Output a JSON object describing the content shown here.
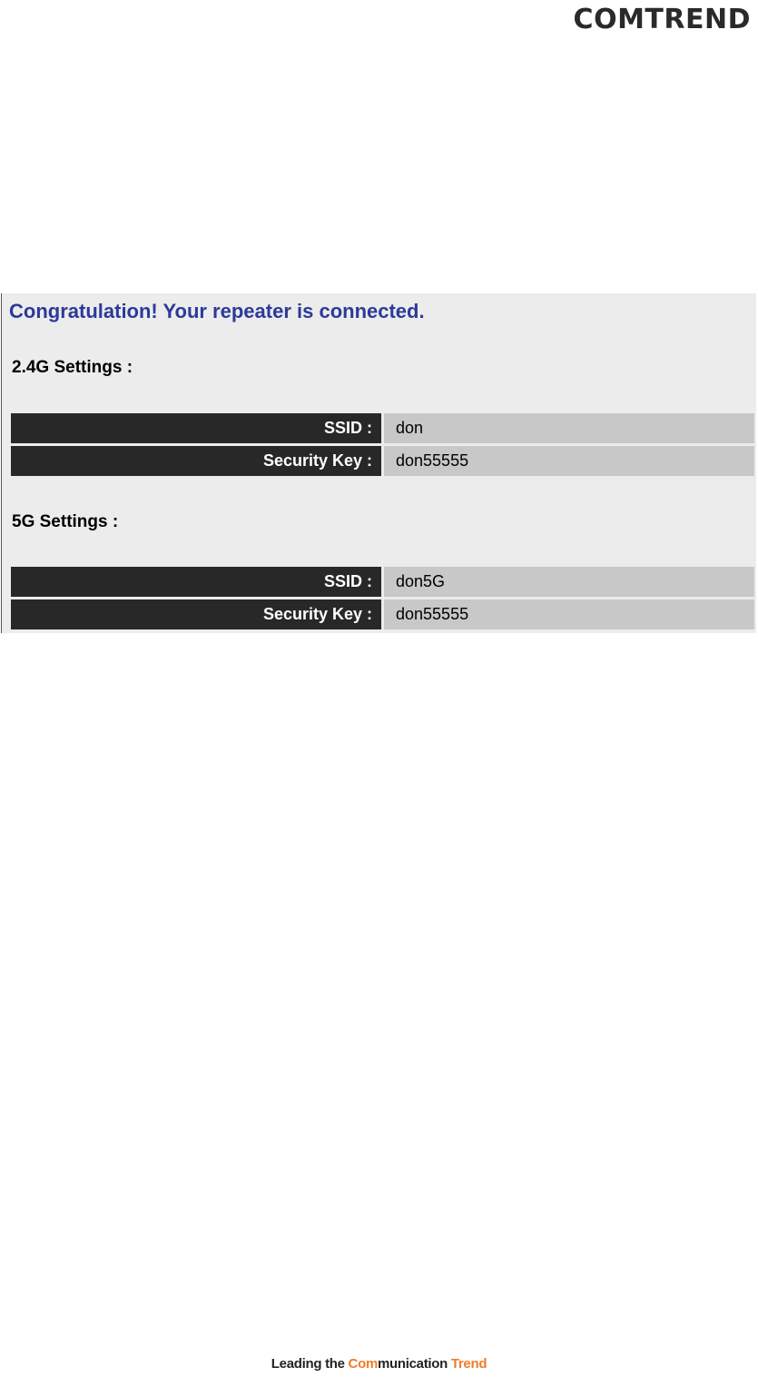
{
  "header": {
    "logo_text": "COMTREND"
  },
  "panel": {
    "message": "Congratulation! Your repeater is connected.",
    "sections": [
      {
        "title": "2.4G Settings :",
        "rows": [
          {
            "label": "SSID :",
            "value": "don"
          },
          {
            "label": "Security Key :",
            "value": "don55555"
          }
        ]
      },
      {
        "title": "5G Settings :",
        "rows": [
          {
            "label": "SSID :",
            "value": "don5G"
          },
          {
            "label": "Security Key :",
            "value": "don55555"
          }
        ]
      }
    ]
  },
  "footer": {
    "part1": "Leading the ",
    "part2": "Com",
    "part3": "munication ",
    "part4": "Trend"
  },
  "colors": {
    "message_text": "#2b3a99",
    "label_bg": "#282828",
    "value_bg": "#c8c8c8",
    "panel_bg": "#ececec",
    "footer_accent": "#f07b2a"
  }
}
